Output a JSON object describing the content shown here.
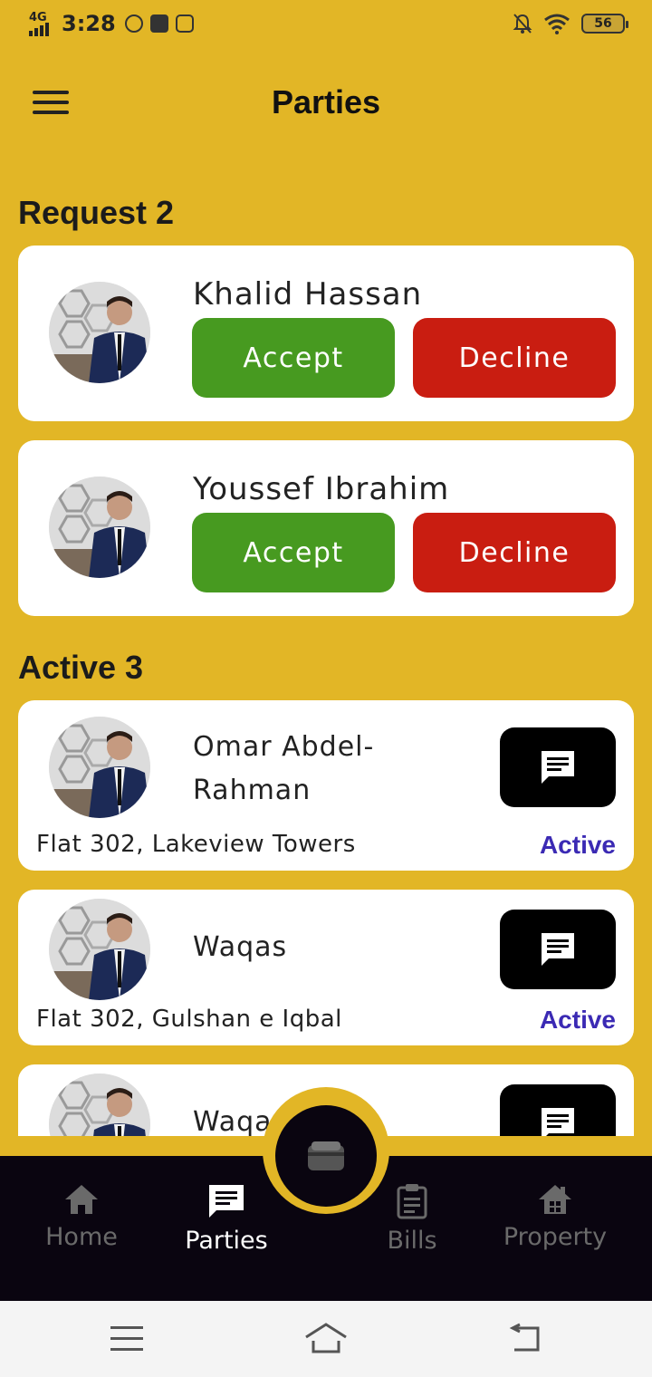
{
  "status_bar": {
    "network": "4G",
    "time": "3:28",
    "battery": "56",
    "left_icons": [
      "whatsapp-icon",
      "mail-icon",
      "instagram-icon"
    ],
    "right_icons": [
      "mute-bell-icon",
      "wifi-icon",
      "battery-icon"
    ]
  },
  "header": {
    "title": "Parties",
    "menu_icon": "hamburger-menu-icon"
  },
  "requests": {
    "title": "Request 2",
    "items": [
      {
        "name": "Khalid Hassan",
        "accept": "Accept",
        "decline": "Decline"
      },
      {
        "name": "Youssef Ibrahim",
        "accept": "Accept",
        "decline": "Decline"
      }
    ]
  },
  "active": {
    "title": "Active 3",
    "items": [
      {
        "name": "Omar Abdel-\nRahman",
        "address": "Flat 302, Lakeview Towers",
        "status": "Active"
      },
      {
        "name": "Waqas",
        "address": "Flat 302, Gulshan e Iqbal",
        "status": "Active"
      },
      {
        "name": "Waqas",
        "address": "",
        "status": ""
      }
    ]
  },
  "bottom_nav": {
    "fab_icon": "wallet-icon",
    "items": [
      {
        "label": "Home",
        "icon": "home-icon",
        "active": false
      },
      {
        "label": "Parties",
        "icon": "chat-icon",
        "active": true
      },
      {
        "label": "Bills",
        "icon": "clipboard-icon",
        "active": false
      },
      {
        "label": "Property",
        "icon": "property-icon",
        "active": false
      }
    ]
  },
  "colors": {
    "background": "#E2B626",
    "accept": "#479A20",
    "decline": "#C91D11",
    "active_status": "#3B2AB4",
    "nav_bar": "#0A0510"
  }
}
